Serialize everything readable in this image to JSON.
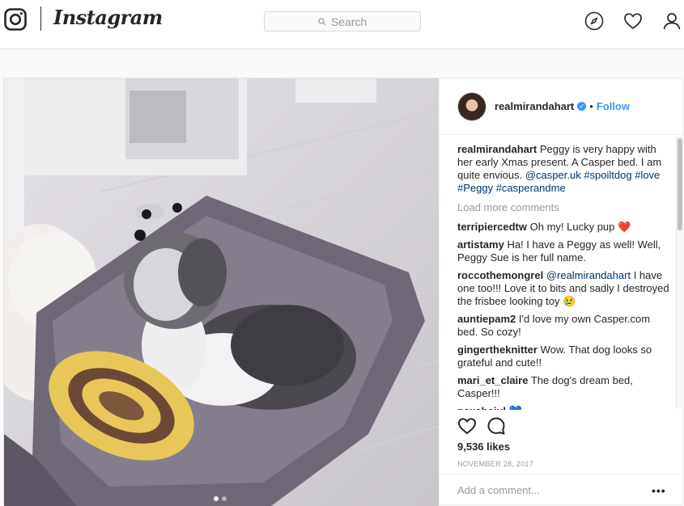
{
  "app": {
    "wordmark": "Instagram"
  },
  "search": {
    "placeholder": "Search"
  },
  "nav": {
    "icons": [
      "compass-icon",
      "heart-icon",
      "profile-icon"
    ]
  },
  "post": {
    "username": "realmirandahart",
    "separator": "•",
    "follow_label": "Follow",
    "caption": {
      "user": "realmirandahart",
      "text": "Peggy is very happy with her early Xmas present. A Casper bed. I am quite envious.",
      "mention": "@casper.uk",
      "tags": "#spoiltdog #love #Peggy #casperandme"
    },
    "load_more": "Load more comments",
    "comments": [
      {
        "user": "terripiercedtw",
        "text": "Oh my! Lucky pup",
        "emoji": "❤️"
      },
      {
        "user": "artistamy",
        "text": "Ha! I have a Peggy as well! Well, Peggy Sue is her full name."
      },
      {
        "user": "roccothemongrel",
        "mention": "@realmirandahart",
        "text": "I have one too!!! Love it to bits and sadly I destroyed the frisbee looking toy",
        "emoji": "😢"
      },
      {
        "user": "auntiepam2",
        "text": "I'd love my own Casper.com bed. So cozy!"
      },
      {
        "user": "gingertheknitter",
        "text": "Wow. That dog looks so grateful and cute!!"
      },
      {
        "user": "mari_et_claire",
        "text": "The dog's dream bed, Casper!!!"
      },
      {
        "user": "paxabaiul",
        "text": "",
        "emoji": "💙"
      }
    ],
    "likes": "9,536 likes",
    "date": "NOVEMBER 28, 2017",
    "add_comment_placeholder": "Add a comment...",
    "more_options": "•••",
    "carousel": {
      "total": 2,
      "active_index": 0
    }
  },
  "colors": {
    "accent": "#3897f0",
    "text": "#262626",
    "muted": "#999999",
    "heart": "#ed4956"
  }
}
